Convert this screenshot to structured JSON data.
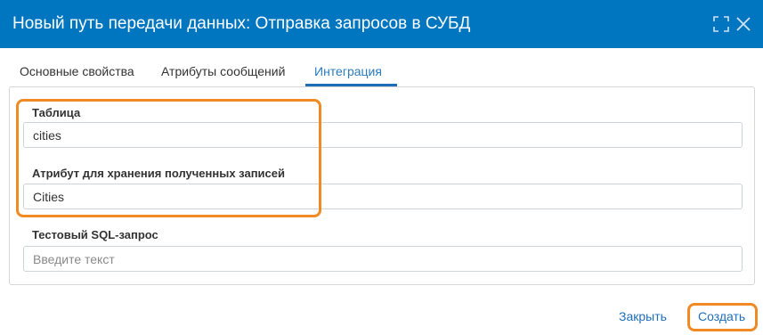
{
  "dialog": {
    "title": "Новый путь передачи данных: Отправка запросов в СУБД"
  },
  "tabs": [
    {
      "label": "Основные свойства",
      "active": false
    },
    {
      "label": "Атрибуты сообщений",
      "active": false
    },
    {
      "label": "Интеграция",
      "active": true
    }
  ],
  "form": {
    "table": {
      "label": "Таблица",
      "value": "cities"
    },
    "storage_attribute": {
      "label": "Атрибут для хранения полученных записей",
      "value": "Cities"
    },
    "test_sql": {
      "label": "Тестовый SQL-запрос",
      "value": "",
      "placeholder": "Введите текст"
    }
  },
  "footer": {
    "close_label": "Закрыть",
    "create_label": "Создать"
  },
  "colors": {
    "titlebar": "#0076c0",
    "accent": "#1f6fb8",
    "highlight": "#f08a24"
  },
  "icons": [
    "maximize-icon",
    "close-icon"
  ]
}
